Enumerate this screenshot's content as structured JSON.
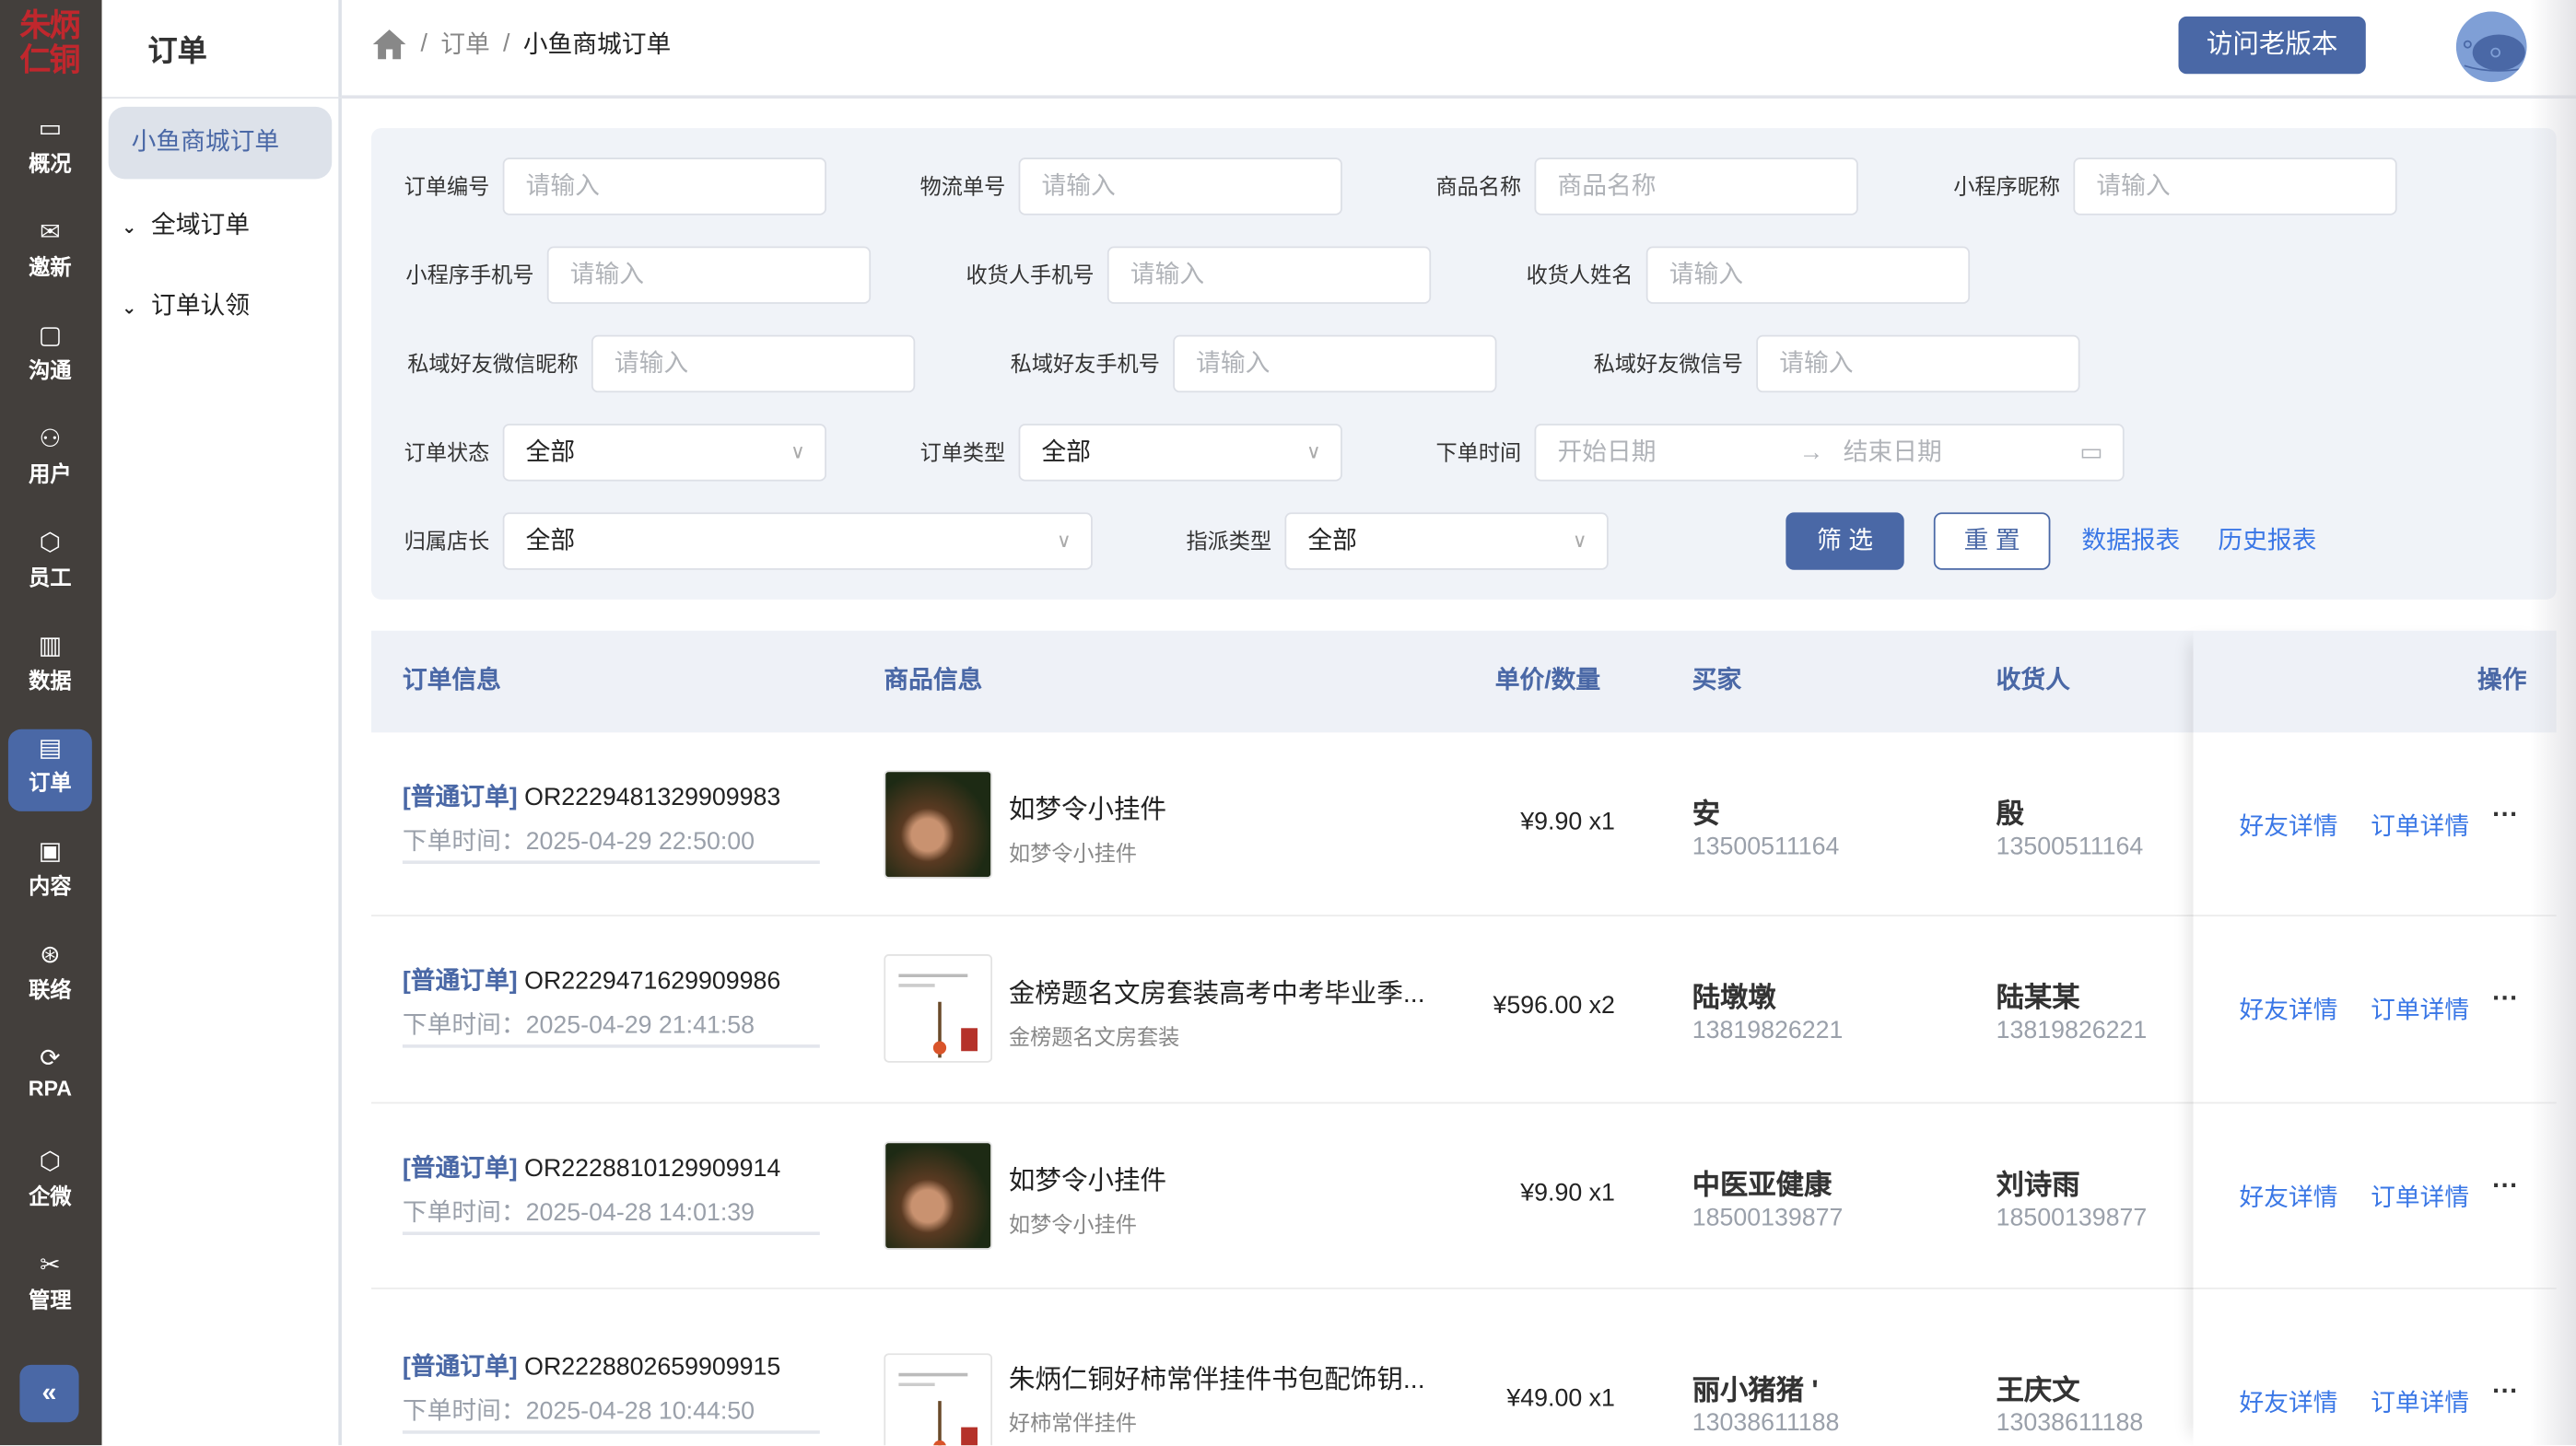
{
  "brand": {
    "logo_text": "朱炳仁铜"
  },
  "rail": {
    "items": [
      {
        "label": "概况",
        "icon": "monitor-icon"
      },
      {
        "label": "邀新",
        "icon": "mail-icon"
      },
      {
        "label": "沟通",
        "icon": "chat-icon"
      },
      {
        "label": "用户",
        "icon": "user-icon"
      },
      {
        "label": "员工",
        "icon": "hex-eye-icon"
      },
      {
        "label": "数据",
        "icon": "bar-chart-icon"
      },
      {
        "label": "订单",
        "icon": "order-icon",
        "active": true
      },
      {
        "label": "内容",
        "icon": "fish-image-icon"
      },
      {
        "label": "联络",
        "icon": "circles-icon"
      },
      {
        "label": "RPA",
        "icon": "rpa-cycle-icon"
      },
      {
        "label": "企微",
        "icon": "hex-eye-icon"
      },
      {
        "label": "管理",
        "icon": "tools-icon"
      }
    ],
    "collapse": "«"
  },
  "subnav": {
    "title": "订单",
    "active": "小鱼商城订单",
    "items": [
      "全域订单",
      "订单认领"
    ]
  },
  "breadcrumb": [
    "订单",
    "小鱼商城订单"
  ],
  "header": {
    "old_version": "访问老版本"
  },
  "filters": {
    "order_no": {
      "label": "订单编号",
      "placeholder": "请输入"
    },
    "logistics_no": {
      "label": "物流单号",
      "placeholder": "请输入"
    },
    "product_name": {
      "label": "商品名称",
      "placeholder": "商品名称"
    },
    "mp_nickname": {
      "label": "小程序昵称",
      "placeholder": "请输入"
    },
    "mp_phone": {
      "label": "小程序手机号",
      "placeholder": "请输入"
    },
    "receiver_phone": {
      "label": "收货人手机号",
      "placeholder": "请输入"
    },
    "receiver_name": {
      "label": "收货人姓名",
      "placeholder": "请输入"
    },
    "wx_nickname": {
      "label": "私域好友微信昵称",
      "placeholder": "请输入"
    },
    "friend_phone": {
      "label": "私域好友手机号",
      "placeholder": "请输入"
    },
    "wx_id": {
      "label": "私域好友微信号",
      "placeholder": "请输入"
    },
    "order_status": {
      "label": "订单状态",
      "value": "全部"
    },
    "order_type": {
      "label": "订单类型",
      "value": "全部"
    },
    "order_time": {
      "label": "下单时间",
      "start": "开始日期",
      "end": "结束日期",
      "sep": "→"
    },
    "store_owner": {
      "label": "归属店长",
      "value": "全部"
    },
    "assign_type": {
      "label": "指派类型",
      "value": "全部"
    },
    "search": "筛 选",
    "reset": "重 置",
    "data_report": "数据报表",
    "history_report": "历史报表"
  },
  "table": {
    "headers": [
      "订单信息",
      "商品信息",
      "单价/数量",
      "买家",
      "收货人",
      "操作"
    ],
    "rows": [
      {
        "type": "[普通订单]",
        "id": "OR2229481329909983",
        "time_label": "下单时间：",
        "time": "2025-04-29 22:50:00",
        "product": "如梦令小挂件",
        "product_sub": "如梦令小挂件",
        "thumb": "photo",
        "price": "¥9.90 x1",
        "buyer": "安",
        "buyer_phone": "13500511164",
        "receiver": "殷",
        "receiver_phone": "13500511164"
      },
      {
        "type": "[普通订单]",
        "id": "OR2229471629909986",
        "time_label": "下单时间：",
        "time": "2025-04-29 21:41:58",
        "product": "金榜题名文房套装高考中考毕业季...",
        "product_sub": "金榜题名文房套装",
        "thumb": "doc",
        "price": "¥596.00 x2",
        "buyer": "陆墩墩",
        "buyer_phone": "13819826221",
        "receiver": "陆某某",
        "receiver_phone": "13819826221"
      },
      {
        "type": "[普通订单]",
        "id": "OR2228810129909914",
        "time_label": "下单时间：",
        "time": "2025-04-28 14:01:39",
        "product": "如梦令小挂件",
        "product_sub": "如梦令小挂件",
        "thumb": "photo",
        "price": "¥9.90 x1",
        "buyer": "中医亚健康",
        "buyer_phone": "18500139877",
        "receiver": "刘诗雨",
        "receiver_phone": "18500139877"
      },
      {
        "type": "[普通订单]",
        "id": "OR2228802659909915",
        "time_label": "下单时间：",
        "time": "2025-04-28 10:44:50",
        "product": "朱炳仁铜好柿常伴挂件书包配饰钥...",
        "product_sub": "好柿常伴挂件",
        "thumb": "doc",
        "price": "¥49.00 x1",
        "buyer": "丽小猪猪 '",
        "buyer_phone": "13038611188",
        "receiver": "王庆文",
        "receiver_phone": "13038611188"
      }
    ],
    "actions": {
      "friend": "好友详情",
      "order": "订单详情",
      "more": "···"
    }
  }
}
